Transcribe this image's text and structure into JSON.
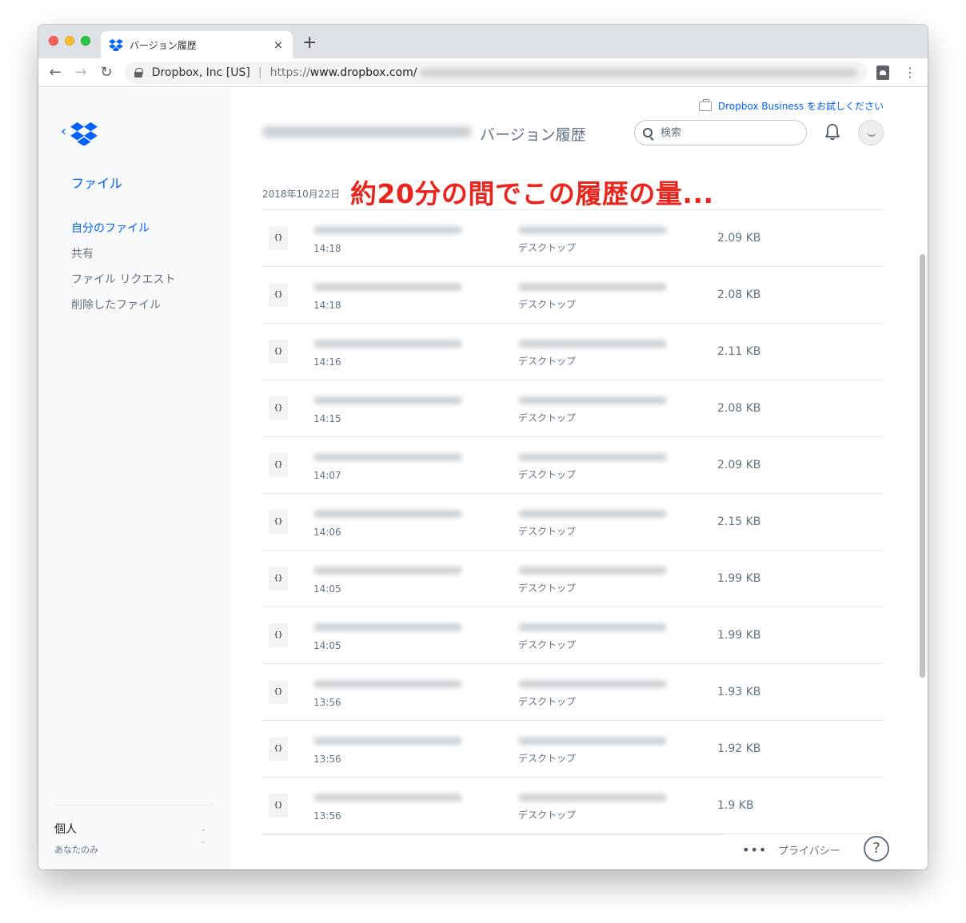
{
  "browser": {
    "tab_title": "バージョン履歴",
    "tab_close": "×",
    "new_tab": "+",
    "site_identity": "Dropbox, Inc [US]",
    "url_scheme": "https://",
    "url_host": "www.dropbox.com/",
    "menu": "⋮"
  },
  "header": {
    "business_link": "Dropbox Business をお試しください",
    "page_title": "バージョン履歴",
    "search_placeholder": "検索"
  },
  "sidebar": {
    "back": "‹",
    "files_label": "ファイル",
    "items": [
      {
        "label": "自分のファイル",
        "active": true
      },
      {
        "label": "共有"
      },
      {
        "label": "ファイル リクエスト"
      },
      {
        "label": "削除したファイル"
      }
    ],
    "account_name": "個人",
    "account_sub": "あなたのみ"
  },
  "date_label": "2018年10月22日",
  "annotation": "約20分の間でこの履歴の量...",
  "file_icon_label": "{}",
  "versions": [
    {
      "time": "14:18",
      "device": "デスクトップ",
      "size": "2.09 KB"
    },
    {
      "time": "14:18",
      "device": "デスクトップ",
      "size": "2.08 KB"
    },
    {
      "time": "14:16",
      "device": "デスクトップ",
      "size": "2.11 KB"
    },
    {
      "time": "14:15",
      "device": "デスクトップ",
      "size": "2.08 KB"
    },
    {
      "time": "14:07",
      "device": "デスクトップ",
      "size": "2.09 KB"
    },
    {
      "time": "14:06",
      "device": "デスクトップ",
      "size": "2.15 KB"
    },
    {
      "time": "14:05",
      "device": "デスクトップ",
      "size": "1.99 KB"
    },
    {
      "time": "14:05",
      "device": "デスクトップ",
      "size": "1.99 KB"
    },
    {
      "time": "13:56",
      "device": "デスクトップ",
      "size": "1.93 KB"
    },
    {
      "time": "13:56",
      "device": "デスクトップ",
      "size": "1.92 KB"
    },
    {
      "time": "13:56",
      "device": "デスクトップ",
      "size": "1.9 KB"
    }
  ],
  "footer": {
    "more": "•••",
    "privacy": "プライバシー",
    "help": "?"
  },
  "colors": {
    "accent": "#0061fe",
    "annotation": "#e8261d",
    "muted_text": "#637282"
  }
}
